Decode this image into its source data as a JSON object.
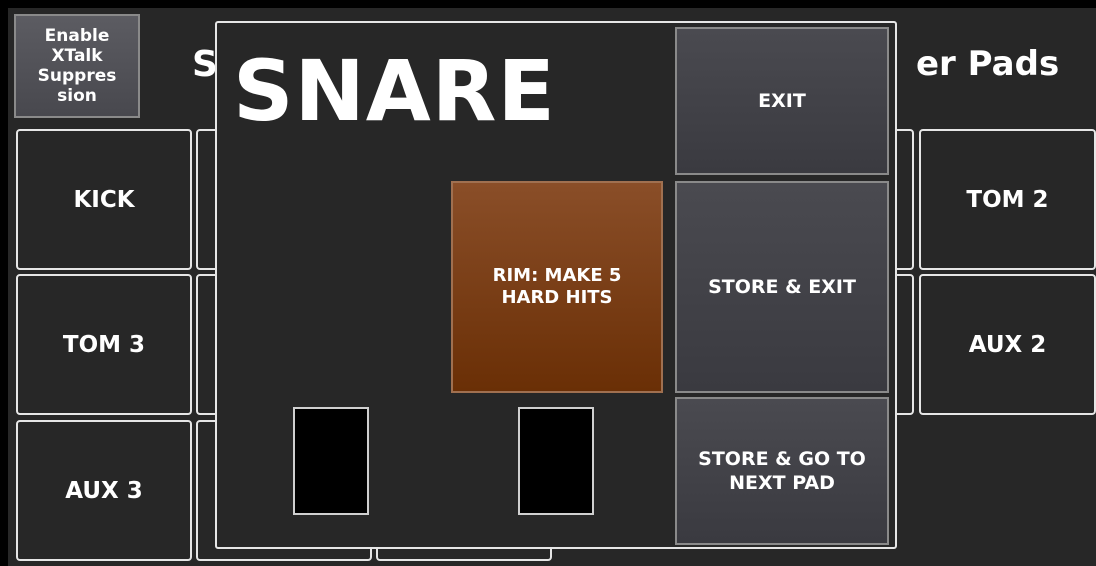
{
  "background": {
    "xtalk_button": "Enable\nXTalk\nSuppres\nsion",
    "title_left_fragment": "S",
    "title_right_fragment": "er Pads",
    "pads": {
      "kick": "KICK",
      "tom2": "TOM 2",
      "tom3": "TOM 3",
      "aux2": "AUX 2",
      "aux3": "AUX 3"
    }
  },
  "modal": {
    "title": "SNARE",
    "instruction": "RIM: MAKE 5\nHARD HITS",
    "buttons": {
      "exit": "EXIT",
      "store_exit": "STORE & EXIT",
      "store_next": "STORE & GO TO\nNEXT PAD"
    }
  },
  "colors": {
    "background": "#272727",
    "accent_orange": "#8a4e28",
    "button_gray": "#45454b"
  }
}
